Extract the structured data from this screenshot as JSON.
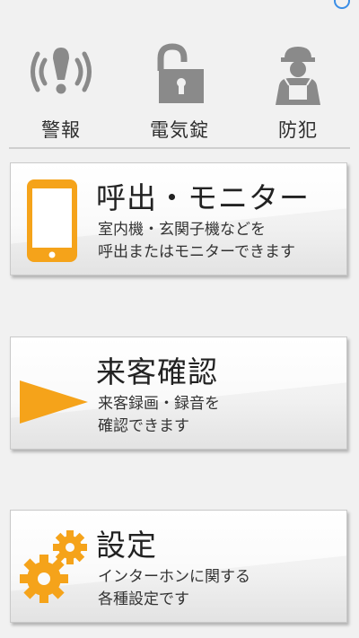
{
  "nav": {
    "items": [
      {
        "label": "警報",
        "icon": "alarm-icon"
      },
      {
        "label": "電気錠",
        "icon": "unlock-icon"
      },
      {
        "label": "防犯",
        "icon": "security-guard-icon"
      }
    ]
  },
  "cards": [
    {
      "title": "呼出・モニター",
      "desc1": "室内機・玄関子機などを",
      "desc2": "呼出またはモニターできます",
      "icon": "smartphone-icon"
    },
    {
      "title": "来客確認",
      "desc1": "来客録画・録音を",
      "desc2": "確認できます",
      "icon": "play-arrow-icon"
    },
    {
      "title": "設定",
      "desc1": "インターホンに関する",
      "desc2": "各種設定です",
      "icon": "gears-icon"
    }
  ],
  "colors": {
    "accent": "#f5a31a",
    "icon_gray": "#8a8a8a",
    "background": "#f1f1f1"
  }
}
